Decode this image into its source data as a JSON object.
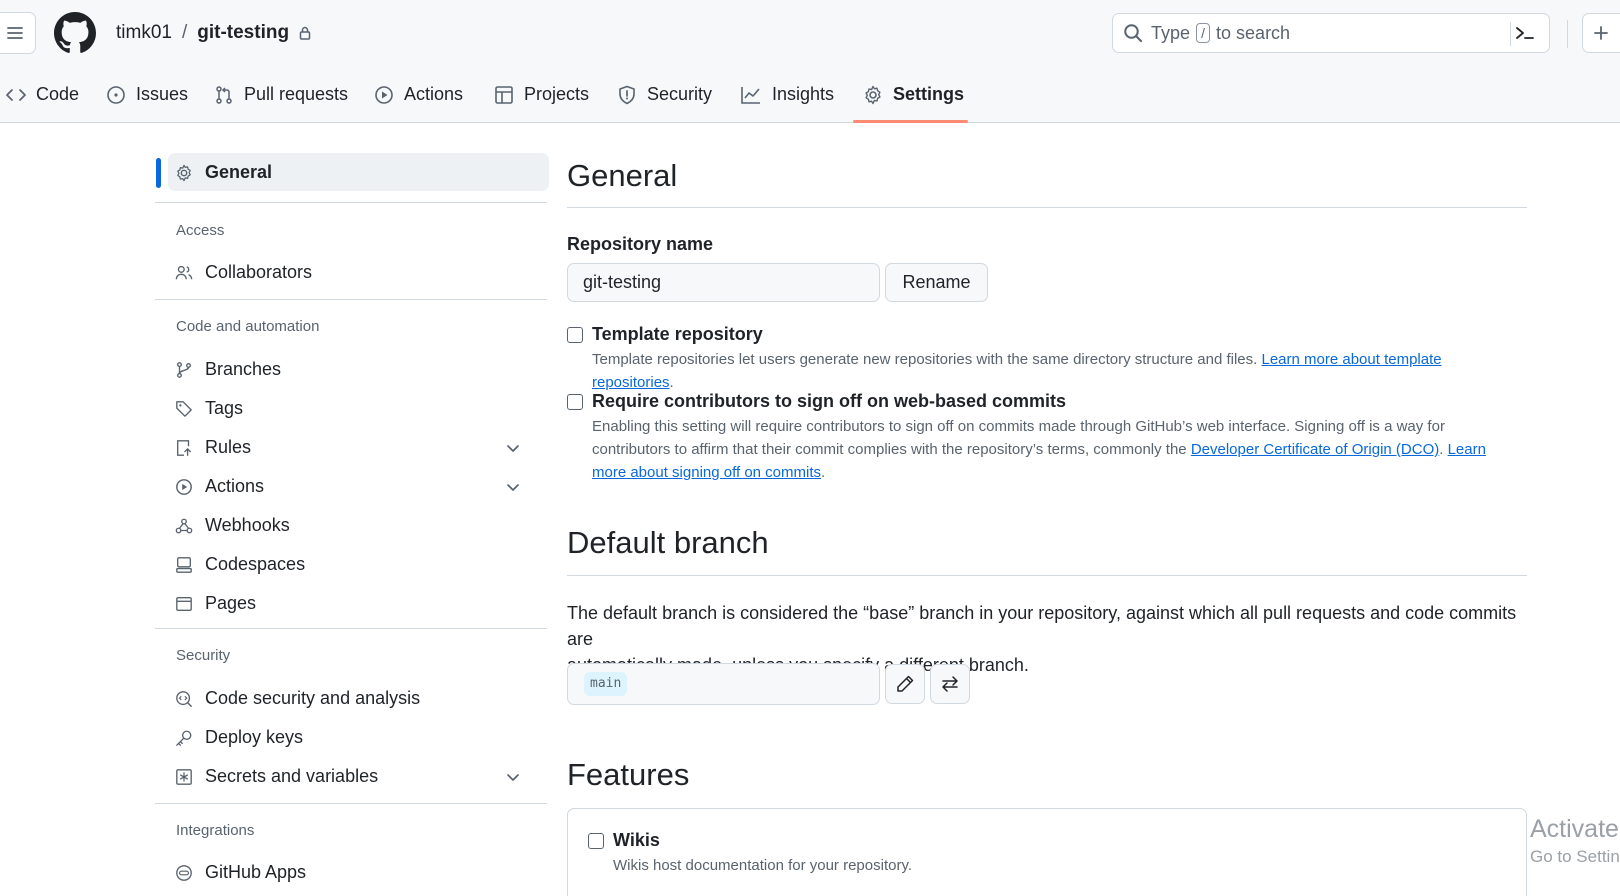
{
  "header": {
    "owner": "timk01",
    "separator": "/",
    "repo": "git-testing",
    "search_prefix": "Type",
    "search_key": "/",
    "search_suffix": "to search"
  },
  "repo_nav": {
    "items": [
      {
        "label": "Code",
        "icon": "code-icon"
      },
      {
        "label": "Issues",
        "icon": "issue-opened-icon"
      },
      {
        "label": "Pull requests",
        "icon": "git-pull-request-icon"
      },
      {
        "label": "Actions",
        "icon": "play-icon"
      },
      {
        "label": "Projects",
        "icon": "table-icon"
      },
      {
        "label": "Security",
        "icon": "shield-icon"
      },
      {
        "label": "Insights",
        "icon": "graph-icon"
      },
      {
        "label": "Settings",
        "icon": "gear-icon",
        "active": true
      }
    ]
  },
  "sidebar": {
    "general": "General",
    "sections": [
      {
        "heading": "Access",
        "items": [
          "Collaborators"
        ]
      },
      {
        "heading": "Code and automation",
        "items": [
          "Branches",
          "Tags",
          "Rules",
          "Actions",
          "Webhooks",
          "Codespaces",
          "Pages"
        ]
      },
      {
        "heading": "Security",
        "items": [
          "Code security and analysis",
          "Deploy keys",
          "Secrets and variables"
        ]
      },
      {
        "heading": "Integrations",
        "items": [
          "GitHub Apps"
        ]
      }
    ]
  },
  "main": {
    "general_title": "General",
    "repo_name_label": "Repository name",
    "repo_name_value": "git-testing",
    "rename_button": "Rename",
    "template": {
      "title": "Template repository",
      "desc": "Template repositories let users generate new repositories with the same directory structure and files.",
      "link": "Learn more about template repositories",
      "end": "."
    },
    "signoff": {
      "title": "Require contributors to sign off on web-based commits",
      "desc1": "Enabling this setting will require contributors to sign off on commits made through GitHub’s web interface. Signing off is a way for",
      "desc2": "contributors to affirm that their commit complies with the repository’s terms, commonly the",
      "link1": "Developer Certificate of Origin (DCO)",
      "mid": ".",
      "link2a": "Learn",
      "link2b": "more about signing off on commits",
      "end": "."
    },
    "default_branch_title": "Default branch",
    "default_branch_desc1": "The default branch is considered the “base” branch in your repository, against which all pull requests and code commits are",
    "default_branch_desc2": "automatically made, unless you specify a different branch.",
    "branch_name": "main",
    "features_title": "Features",
    "wikis": {
      "title": "Wikis",
      "desc": "Wikis host documentation for your repository."
    }
  },
  "watermark": {
    "line1": "Activate",
    "line2": "Go to Settin"
  }
}
